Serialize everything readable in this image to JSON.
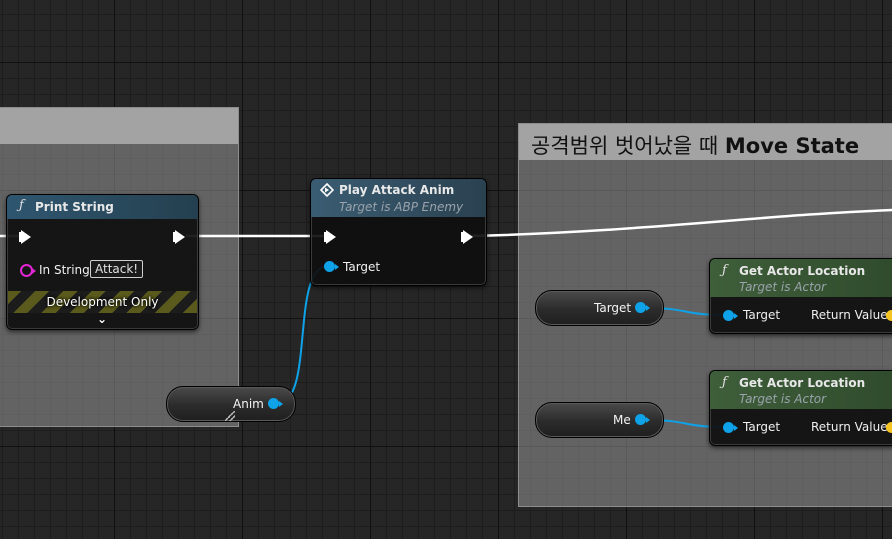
{
  "comments": {
    "left": {
      "title": ""
    },
    "right": {
      "title_prefix": "공격범위 벗어났을 때 ",
      "title_bold": "Move State"
    }
  },
  "nodes": {
    "print_string": {
      "icon": "function-icon",
      "title": "Print String",
      "in_string_label": "In String",
      "in_string_value": "Attack!",
      "dev_label": "Development Only",
      "header_color": "#2f5670"
    },
    "play_attack_anim": {
      "icon": "event-diamond-icon",
      "title": "Play Attack Anim",
      "subtitle": "Target is ABP Enemy",
      "target_label": "Target",
      "header_color": "#3a5c72"
    },
    "get_actor_location_1": {
      "icon": "function-icon",
      "title": "Get Actor Location",
      "subtitle": "Target is Actor",
      "target_label": "Target",
      "return_label": "Return Value",
      "header_color": "#3f5e3a"
    },
    "get_actor_location_2": {
      "icon": "function-icon",
      "title": "Get Actor Location",
      "subtitle": "Target is Actor",
      "target_label": "Target",
      "return_label": "Return Value",
      "header_color": "#3f5e3a"
    }
  },
  "variables": {
    "anim": {
      "label": "Anim"
    },
    "target": {
      "label": "Target"
    },
    "me": {
      "label": "Me"
    }
  },
  "colors": {
    "exec_wire": "#ffffff",
    "object_pin": "#0ea2e8",
    "vector_pin": "#f6c421",
    "string_pin": "#e225d5"
  }
}
